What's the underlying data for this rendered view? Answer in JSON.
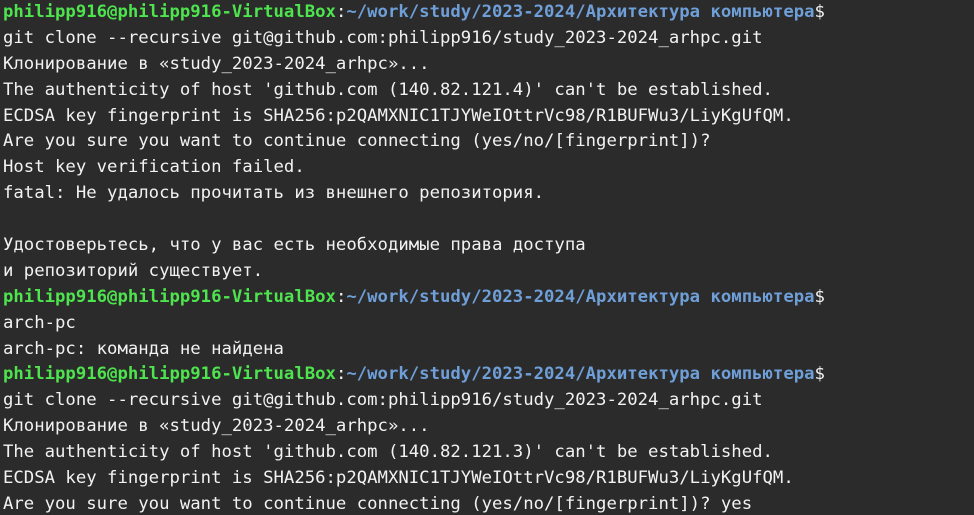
{
  "terminal": {
    "prompt": {
      "user_host": "philipp916@philipp916-VirtualBox",
      "separator": ":",
      "path": "~/work/study/2023-2024/Архитектура компьютера",
      "symbol": "$"
    },
    "colors": {
      "background": "#2b2b2b",
      "text": "#f2f2f2",
      "user_host": "#4ee44e",
      "path": "#6f9fd8"
    },
    "lines": {
      "l1": "git clone --recursive git@github.com:philipp916/study_2023-2024_arhpc.git",
      "l2": "Клонирование в «study_2023-2024_arhpc»...",
      "l3": "The authenticity of host 'github.com (140.82.121.4)' can't be established.",
      "l4": "ECDSA key fingerprint is SHA256:p2QAMXNIC1TJYWeIOttrVc98/R1BUFWu3/LiyKgUfQM.",
      "l5": "Are you sure you want to continue connecting (yes/no/[fingerprint])?",
      "l6": "Host key verification failed.",
      "l7": "fatal: Не удалось прочитать из внешнего репозитория.",
      "l8": "Удостоверьтесь, что у вас есть необходимые права доступа",
      "l9": "и репозиторий существует.",
      "l10": "arch-pc",
      "l11": "arch-pc: команда не найдена",
      "l12": "git clone --recursive git@github.com:philipp916/study_2023-2024_arhpc.git",
      "l13": "Клонирование в «study_2023-2024_arhpc»...",
      "l14": "The authenticity of host 'github.com (140.82.121.3)' can't be established.",
      "l15": "ECDSA key fingerprint is SHA256:p2QAMXNIC1TJYWeIOttrVc98/R1BUFWu3/LiyKgUfQM.",
      "l16": "Are you sure you want to continue connecting (yes/no/[fingerprint])? yes"
    }
  }
}
